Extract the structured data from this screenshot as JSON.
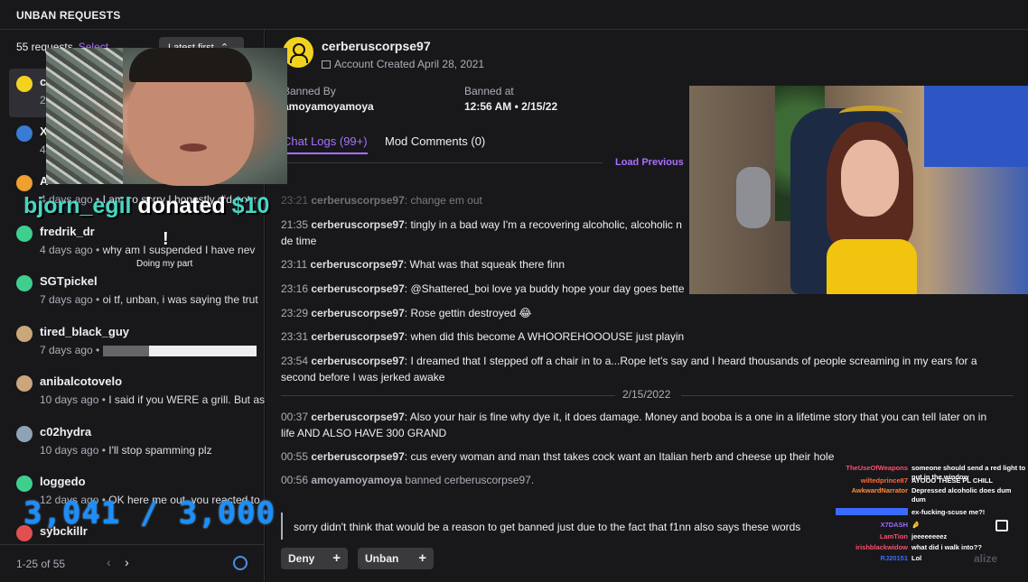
{
  "topbar": {
    "title": "UNBAN REQUESTS"
  },
  "left": {
    "count": "55 requests",
    "select": "Select",
    "sort": "Latest first",
    "requests": [
      {
        "name": "c",
        "meta": "2",
        "msg": "",
        "avatar_color": "#f3d21f"
      },
      {
        "name": "X",
        "meta": "4",
        "msg": "",
        "avatar_color": "#3a7bd5"
      },
      {
        "name": "A",
        "meta": "4 days ago",
        "msg": "I am so sorry I honestly did not r",
        "avatar_color": "#f0a030"
      },
      {
        "name": "fredrik_dr",
        "meta": "4 days ago",
        "msg": "why am I suspended I have nev",
        "avatar_color": "#3ecf8e"
      },
      {
        "name": "SGTpickel",
        "meta": "7 days ago",
        "msg": "oi tf, unban, i was saying the trut",
        "avatar_color": "#3ecf8e"
      },
      {
        "name": "tired_black_guy",
        "meta": "7 days ago",
        "msg": "",
        "avatar_color": "#c9a77a"
      },
      {
        "name": "anibalcotovelo",
        "meta": "10 days ago",
        "msg": "I said if you WERE a grill. But as",
        "avatar_color": "#c9a77a"
      },
      {
        "name": "c02hydra",
        "meta": "10 days ago",
        "msg": "I'll stop spamming plz",
        "avatar_color": "#8fa3b8"
      },
      {
        "name": "loggedo",
        "meta": "12 days ago",
        "msg": "OK here me out, you reacted to",
        "avatar_color": "#3ecf8e"
      },
      {
        "name": "sybckillr",
        "meta": "",
        "msg": "",
        "avatar_color": "#e05050"
      }
    ],
    "pagination": "1-25 of 55"
  },
  "user": {
    "name": "cerberuscorpse97",
    "created": "Account Created April 28, 2021",
    "banned_by_label": "Banned By",
    "banned_by": "amoyamoyamoya",
    "banned_at_label": "Banned at",
    "banned_at": "12:56 AM • 2/15/22"
  },
  "tabs": {
    "chat_logs": "Chat Logs (99+)",
    "mod_comments": "Mod Comments (0)"
  },
  "load_previous": "Load Previous",
  "logs": [
    {
      "ts": "23:21",
      "user": "cerberuscorpse97",
      "msg": ": change em out"
    },
    {
      "ts": "21:35",
      "user": "cerberuscorpse97",
      "msg": ": tingly in a bad way I'm a recovering alcoholic, alcoholic n"
    },
    {
      "ts": "",
      "user": "",
      "msg": "de time"
    },
    {
      "ts": "23:11",
      "user": "cerberuscorpse97",
      "msg": ": What was that squeak there finn"
    },
    {
      "ts": "23:16",
      "user": "cerberuscorpse97",
      "msg": ": @Shattered_boi love ya buddy hope your day goes bette"
    },
    {
      "ts": "23:29",
      "user": "cerberuscorpse97",
      "msg": ": Rose gettin destroyed 😂"
    },
    {
      "ts": "23:31",
      "user": "cerberuscorpse97",
      "msg": ": when did this become A WHOOREHOOOUSE just playin"
    },
    {
      "ts": "23:54",
      "user": "cerberuscorpse97",
      "msg": ": I dreamed that I stepped off a chair in to a...Rope let's say and I heard thousands of people screaming in my ears for a"
    },
    {
      "ts": "",
      "user": "",
      "msg": "second before I was jerked awake"
    },
    {
      "ts": "00:37",
      "user": "cerberuscorpse97",
      "msg": ": Also your hair is fine why dye it, it does damage. Money and booba is a one in a lifetime story that you can tell later on in"
    },
    {
      "ts": "",
      "user": "",
      "msg": "life AND ALSO HAVE 300 GRAND"
    },
    {
      "ts": "00:55",
      "user": "cerberuscorpse97",
      "msg": ": cus every woman and man thst takes cock want an Italian herb and cheese up their hole"
    },
    {
      "ts": "00:56",
      "user": "amoyamoyamoya",
      "msg": " banned cerberuscorpse97."
    }
  ],
  "date_separator": "2/15/2022",
  "appeal": "sorry didn't think that would be a reason to get banned just due to the fact that f1nn also says these words",
  "buttons": {
    "deny": "Deny",
    "unban": "Unban",
    "plus": "+",
    "finalize": "alize"
  },
  "overlay": {
    "donor": "bjorn_egil",
    "donated": "donated",
    "amount": "$10",
    "bang": "!",
    "donate_msg": "Doing my part",
    "goal": "3,041 / 3,000"
  },
  "chat": [
    {
      "user": "TheUseOfWeapons",
      "color": "#ff4d6d",
      "text": "someone should send a red light to put in the window"
    },
    {
      "user": "wiltedprince87",
      "color": "#ff6a3d",
      "text": "AYOOO THESE PL CHILL"
    },
    {
      "user": "AwkwardNarrator",
      "color": "#ff8c42",
      "text": "Depressed alcoholic does dum dum"
    },
    {
      "user": "",
      "color": "#3a6bff",
      "text": "ex-fucking-scuse me?!"
    },
    {
      "user": "X7DASH",
      "color": "#9b6bff",
      "text": "🤌"
    },
    {
      "user": "LamTion",
      "color": "#ff4d6d",
      "text": "jeeeeeeeez"
    },
    {
      "user": "irishblackwidow",
      "color": "#ff4d6d",
      "text": "what did i walk into??"
    },
    {
      "user": "RJ20151",
      "color": "#3a6bff",
      "text": "Lol"
    }
  ],
  "colors": {
    "accent": "#a970ff",
    "bg": "#18181b",
    "goal": "#1a8fff",
    "donor": "#48d6c4"
  }
}
